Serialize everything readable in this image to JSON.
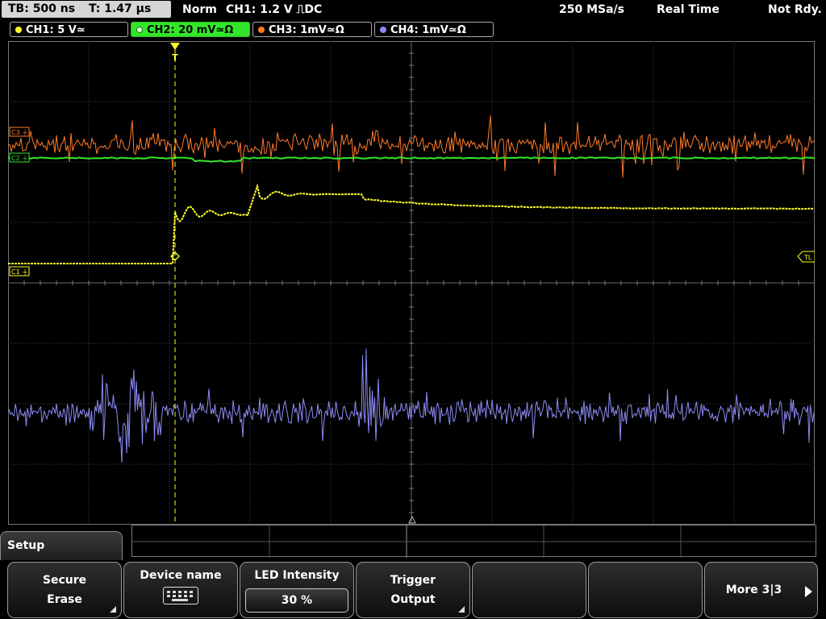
{
  "status": {
    "tb_label": "TB: 500 ns",
    "t_label": "T: 1.47 µs",
    "mode": "Norm",
    "trigger": "CH1: 1.2 V ⎍DC",
    "sample_rate": "250 MSa/s",
    "acq_mode": "Real Time",
    "state": "Not Rdy."
  },
  "channels": [
    {
      "label": "CH1: 5 V≃",
      "color": "#ffff2a",
      "active": false
    },
    {
      "label": "CH2: 20 mV≃Ω",
      "color": "#34e62a",
      "active": true
    },
    {
      "label": "CH3: 1mV≃Ω",
      "color": "#ff7a2a",
      "active": false
    },
    {
      "label": "CH4: 1mV≃Ω",
      "color": "#8c8cf5",
      "active": false
    }
  ],
  "markers": {
    "c3": "C3",
    "c2": "C2",
    "c1": "C1",
    "trigger_level": "TL",
    "trigger_pos": "T"
  },
  "colors": {
    "ch1": "#ffff2a",
    "ch2": "#34e62a",
    "ch3": "#ff7a2a",
    "ch4": "#8c8cf5",
    "grid": "#5a5a5a"
  },
  "menu": {
    "tab_label": "Setup",
    "keys": [
      {
        "line1": "Secure",
        "line2": "Erase"
      },
      {
        "line1": "Device name",
        "icon": "keyboard-icon"
      },
      {
        "line1": "LED Intensity",
        "value": "30 %"
      },
      {
        "line1": "Trigger",
        "line2": "Output"
      },
      {
        "line1": ""
      },
      {
        "line1": ""
      },
      {
        "line1": "More 3|3"
      }
    ]
  }
}
